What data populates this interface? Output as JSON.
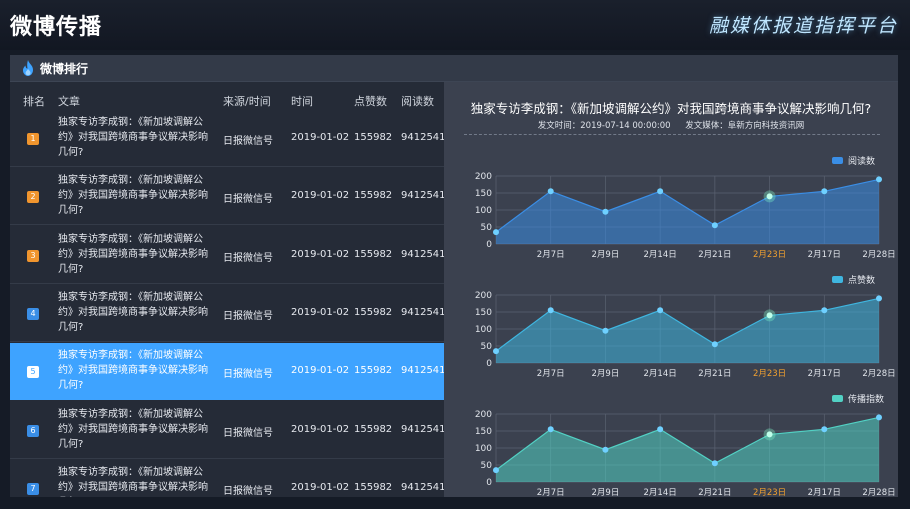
{
  "header": {
    "title": "微博传播",
    "brand": "融媒体报道指挥平台"
  },
  "panel": {
    "title": "微博排行",
    "columns": [
      "排名",
      "文章",
      "来源/时间",
      "时间",
      "点赞数",
      "阅读数"
    ],
    "rows": [
      {
        "rank": "1",
        "article": "独家专访李成钢：《新加坡调解公约》对我国跨境商事争议解决影响几何?",
        "source": "日报微信号",
        "date": "2019-01-02",
        "likes": "155982",
        "reads": "9412541"
      },
      {
        "rank": "2",
        "article": "独家专访李成钢：《新加坡调解公约》对我国跨境商事争议解决影响几何?",
        "source": "日报微信号",
        "date": "2019-01-02",
        "likes": "155982",
        "reads": "9412541"
      },
      {
        "rank": "3",
        "article": "独家专访李成钢：《新加坡调解公约》对我国跨境商事争议解决影响几何?",
        "source": "日报微信号",
        "date": "2019-01-02",
        "likes": "155982",
        "reads": "9412541"
      },
      {
        "rank": "4",
        "article": "独家专访李成钢：《新加坡调解公约》对我国跨境商事争议解决影响几何?",
        "source": "日报微信号",
        "date": "2019-01-02",
        "likes": "155982",
        "reads": "9412541"
      },
      {
        "rank": "5",
        "article": "独家专访李成钢：《新加坡调解公约》对我国跨境商事争议解决影响几何?",
        "source": "日报微信号",
        "date": "2019-01-02",
        "likes": "155982",
        "reads": "9412541"
      },
      {
        "rank": "6",
        "article": "独家专访李成钢：《新加坡调解公约》对我国跨境商事争议解决影响几何?",
        "source": "日报微信号",
        "date": "2019-01-02",
        "likes": "155982",
        "reads": "9412541"
      },
      {
        "rank": "7",
        "article": "独家专访李成钢：《新加坡调解公约》对我国跨境商事争议解决影响几何?",
        "source": "日报微信号",
        "date": "2019-01-02",
        "likes": "155982",
        "reads": "9412541"
      }
    ],
    "selected_rank": "5"
  },
  "detail": {
    "title": "独家专访李成钢：《新加坡调解公约》对我国跨境商事争议解决影响几何?",
    "publish_time_label": "发文时间：",
    "publish_time": "2019-07-14  00:00:00",
    "publish_media_label": "发文媒体：",
    "publish_media": "阜新方向科技资讯网"
  },
  "colors": {
    "accent": "#3ea3ff",
    "rank_top": "#f0952e",
    "rank_normal": "#3a8ee6",
    "highlight_tick": "#f0a030"
  },
  "chart_data": [
    {
      "type": "area",
      "categories": [
        "",
        "2月7日",
        "2月9日",
        "2月14日",
        "2月21日",
        "2月23日",
        "2月17日",
        "2月28日"
      ],
      "highlight_category": "2月23日",
      "series": [
        {
          "name": "阅读数",
          "values": [
            35,
            155,
            95,
            155,
            55,
            140,
            155,
            190
          ],
          "color": "#3a8ee6"
        }
      ],
      "yticks": [
        0,
        50,
        100,
        150,
        200
      ],
      "ylim": [
        0,
        200
      ],
      "grid": true,
      "legend": "top-right"
    },
    {
      "type": "area",
      "categories": [
        "",
        "2月7日",
        "2月9日",
        "2月14日",
        "2月21日",
        "2月23日",
        "2月17日",
        "2月28日"
      ],
      "highlight_category": "2月23日",
      "series": [
        {
          "name": "点赞数",
          "values": [
            35,
            155,
            95,
            155,
            55,
            140,
            155,
            190
          ],
          "color": "#3fb6e0"
        }
      ],
      "yticks": [
        0,
        50,
        100,
        150,
        200
      ],
      "ylim": [
        0,
        200
      ],
      "grid": true,
      "legend": "top-right"
    },
    {
      "type": "area",
      "categories": [
        "",
        "2月7日",
        "2月9日",
        "2月14日",
        "2月21日",
        "2月23日",
        "2月17日",
        "2月28日"
      ],
      "highlight_category": "2月23日",
      "series": [
        {
          "name": "传播指数",
          "values": [
            35,
            155,
            95,
            155,
            55,
            140,
            155,
            190
          ],
          "color": "#52d1c4"
        }
      ],
      "yticks": [
        0,
        50,
        100,
        150,
        200
      ],
      "ylim": [
        0,
        200
      ],
      "grid": true,
      "legend": "top-right"
    }
  ]
}
